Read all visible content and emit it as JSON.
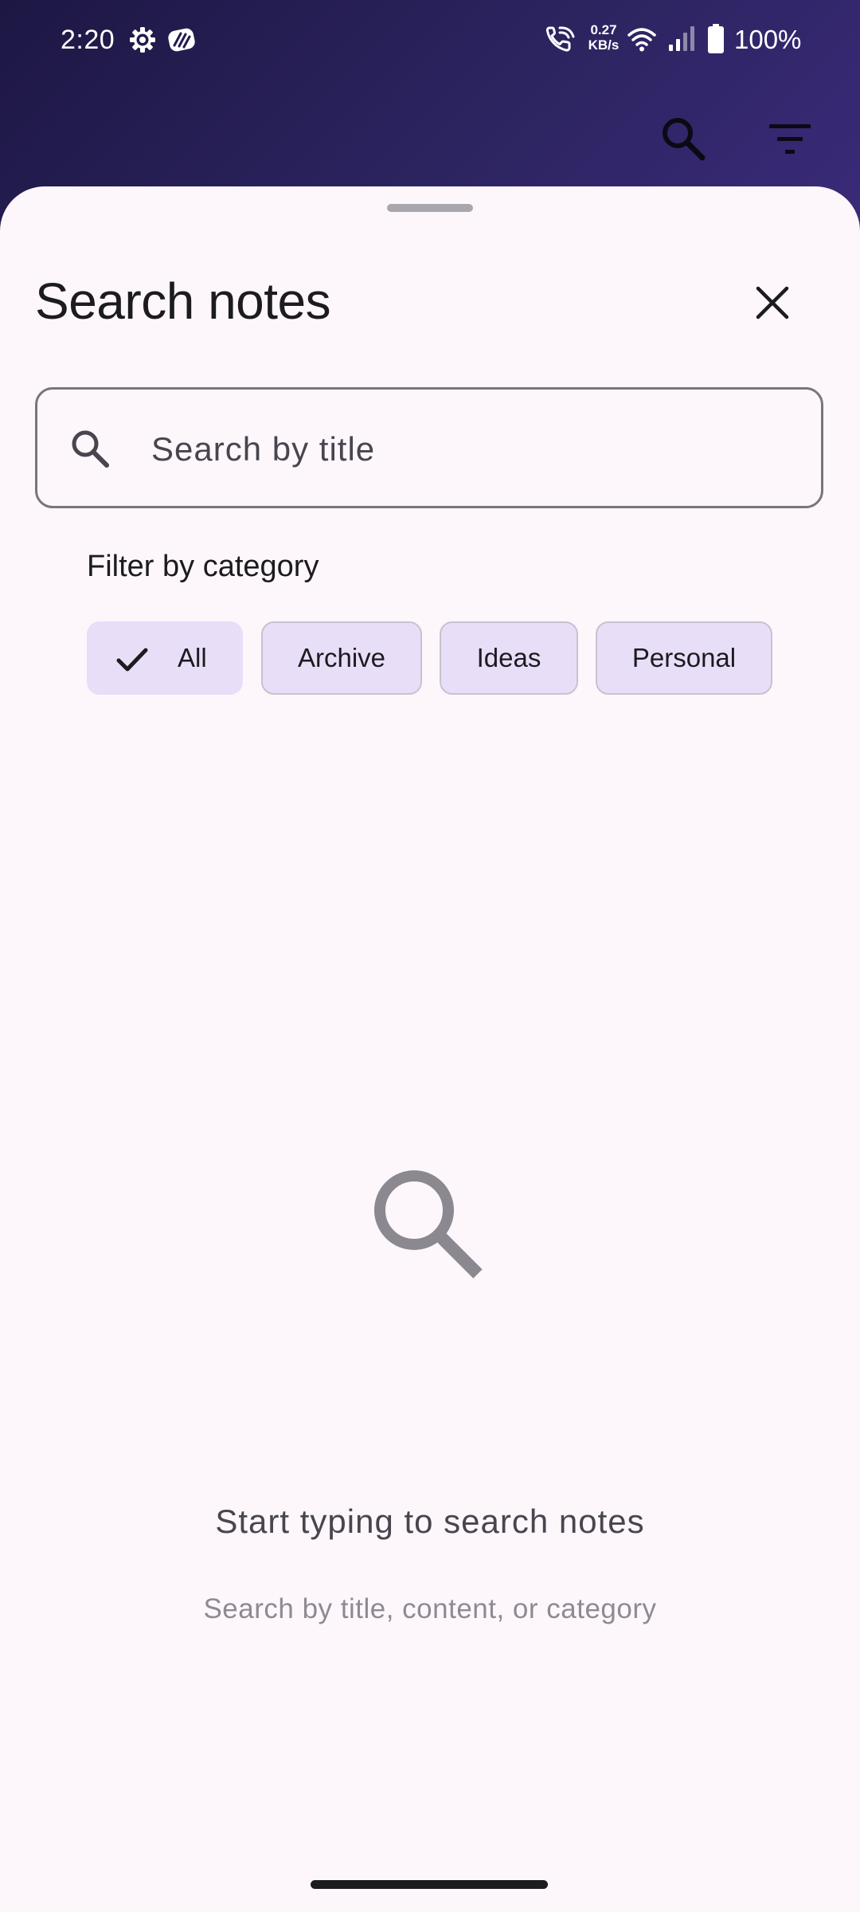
{
  "status_bar": {
    "time": "2:20",
    "net_speed_value": "0.27",
    "net_speed_unit": "KB/s",
    "battery": "100%",
    "icons": [
      "gear-icon",
      "app-notification-icon",
      "wifi-call-icon",
      "wifi-icon",
      "signal-icon",
      "battery-icon"
    ]
  },
  "app_bar": {
    "actions": [
      "search-icon",
      "filter-icon"
    ]
  },
  "sheet": {
    "title": "Search notes",
    "close_icon": "close-icon",
    "search": {
      "placeholder": "Search by title",
      "value": ""
    },
    "filter_label": "Filter by category",
    "chips": [
      {
        "label": "All",
        "selected": true
      },
      {
        "label": "Archive",
        "selected": false
      },
      {
        "label": "Ideas",
        "selected": false
      },
      {
        "label": "Personal",
        "selected": false
      }
    ],
    "empty_state": {
      "icon": "search-icon",
      "title": "Start typing to search notes",
      "subtitle": "Search by title, content, or category"
    }
  },
  "colors": {
    "app_bar_dark": "#1d1744",
    "app_bar_light": "#3b2a7a",
    "sheet_background": "#fdf7fc",
    "chip_background": "#e9def8",
    "text_primary": "#1c1b1f",
    "text_secondary": "#49454f",
    "text_tertiary": "#8e8a93"
  }
}
